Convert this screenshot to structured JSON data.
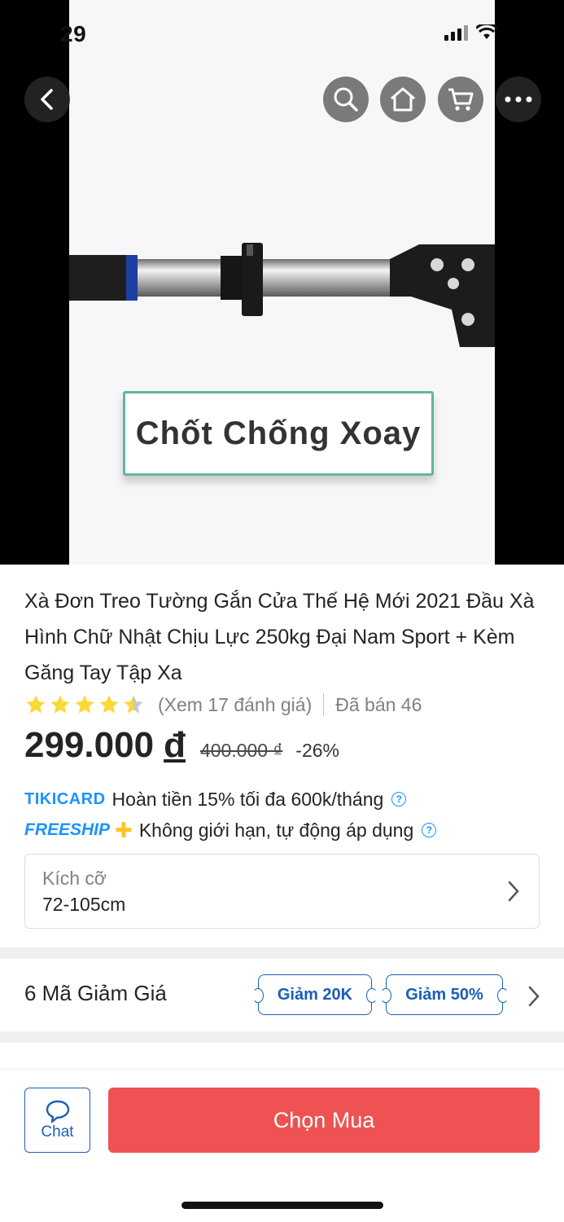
{
  "status_bar": {
    "time": "29"
  },
  "media": {
    "caption": "Chốt Chống Xoay",
    "nav_icons": [
      "chevron-left-icon",
      "search-icon",
      "home-icon",
      "cart-icon",
      "more-icon"
    ]
  },
  "product": {
    "title": "Xà Đơn Treo Tường Gắn Cửa Thế Hệ Mới 2021 Đầu Xà Hình Chữ Nhật Chịu Lực 250kg Đại Nam Sport + Kèm Găng Tay Tập Xa",
    "rating": 4.5,
    "review_link": "(Xem 17 đánh giá)",
    "sold": "Đã bán 46",
    "price": "299.000",
    "currency": "đ",
    "old_price": "400.000 ₫",
    "discount": "-26%"
  },
  "promos": {
    "tikicard_brand": "TIKICARD",
    "tikicard_text": "Hoàn tiền 15% tối đa 600k/tháng",
    "freeship_brand": "FREESHIP",
    "freeship_text": "Không giới hạn, tự động áp dụng"
  },
  "size_selector": {
    "label": "Kích cỡ",
    "value": "72-105cm"
  },
  "coupons": {
    "title": "6 Mã Giảm Giá",
    "items": [
      "Giảm 20K",
      "Giảm 50%"
    ]
  },
  "bottom_bar": {
    "chat_label": "Chat",
    "buy_label": "Chọn Mua"
  },
  "colors": {
    "accent_blue": "#1a94ff",
    "buy_red": "#ee5253",
    "star_yellow": "#fdd836"
  }
}
